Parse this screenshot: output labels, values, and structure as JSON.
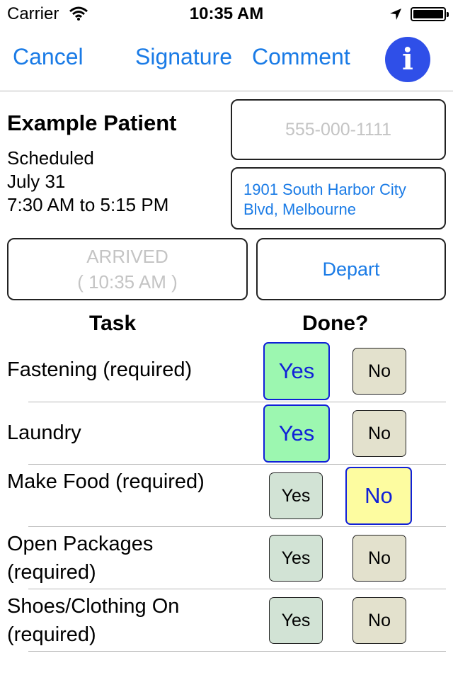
{
  "status_bar": {
    "carrier": "Carrier",
    "time": "10:35 AM"
  },
  "nav": {
    "cancel": "Cancel",
    "signature": "Signature",
    "comment": "Comment",
    "info_icon": "i"
  },
  "patient": {
    "name": "Example Patient",
    "status": "Scheduled",
    "date": "July 31",
    "time_range": "7:30 AM to 5:15 PM",
    "phone_placeholder": "555-000-1111",
    "address": "1901 South Harbor City Blvd, Melbourne"
  },
  "visit": {
    "arrived_label": "ARRIVED",
    "arrived_time": "( 10:35 AM )",
    "depart_label": "Depart"
  },
  "table": {
    "task_header": "Task",
    "done_header": "Done?"
  },
  "tasks": [
    {
      "label": "Fastening (required)",
      "yes": "Yes",
      "no": "No",
      "selected": "yes"
    },
    {
      "label": "Laundry",
      "yes": "Yes",
      "no": "No",
      "selected": "yes"
    },
    {
      "label": "Make Food (required)",
      "yes": "Yes",
      "no": "No",
      "selected": "no"
    },
    {
      "label": "Open Packages (required)",
      "yes": "Yes",
      "no": "No",
      "selected": "none"
    },
    {
      "label": "Shoes/Clothing On (required)",
      "yes": "Yes",
      "no": "No",
      "selected": "none"
    }
  ],
  "colors": {
    "accent": "#1a7be6",
    "info_button": "#2f4fe8",
    "yes_selected": "#9cf7b0",
    "no_selected": "#fdfca0",
    "yes_unselected": "#d2e3d5",
    "no_unselected": "#e3e1cd",
    "selected_text": "#1020d8"
  },
  "icons": [
    "wifi-icon",
    "location-arrow-icon",
    "battery-icon",
    "info-icon"
  ]
}
